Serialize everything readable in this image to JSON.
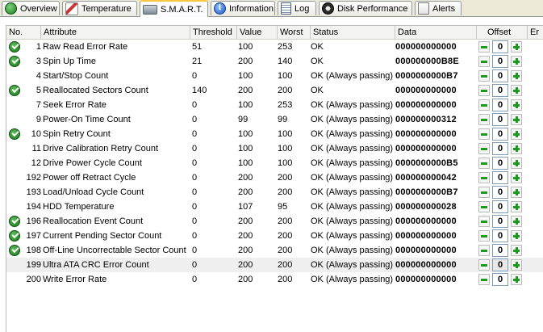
{
  "tabs": [
    {
      "label": "Overview",
      "icon": "overview-icon",
      "active": false
    },
    {
      "label": "Temperature",
      "icon": "temperature-icon",
      "active": false
    },
    {
      "label": "S.M.A.R.T.",
      "icon": "smart-icon",
      "active": true
    },
    {
      "label": "Information",
      "icon": "information-icon",
      "active": false
    },
    {
      "label": "Log",
      "icon": "log-icon",
      "active": false
    },
    {
      "label": "Disk Performance",
      "icon": "disk-performance-icon",
      "active": false
    },
    {
      "label": "Alerts",
      "icon": "alerts-icon",
      "active": false
    }
  ],
  "columns": {
    "no": "No.",
    "attribute": "Attribute",
    "threshold": "Threshold",
    "value": "Value",
    "worst": "Worst",
    "status": "Status",
    "data": "Data",
    "offset": "Offset",
    "extra": "Er"
  },
  "rows": [
    {
      "check": true,
      "no": "1",
      "attribute": "Raw Read Error Rate",
      "threshold": "51",
      "value": "100",
      "worst": "253",
      "status": "OK",
      "data": "000000000000",
      "offset": "0"
    },
    {
      "check": true,
      "no": "3",
      "attribute": "Spin Up Time",
      "threshold": "21",
      "value": "200",
      "worst": "140",
      "status": "OK",
      "data": "000000000B8E",
      "offset": "0"
    },
    {
      "check": false,
      "no": "4",
      "attribute": "Start/Stop Count",
      "threshold": "0",
      "value": "100",
      "worst": "100",
      "status": "OK (Always passing)",
      "data": "0000000000B7",
      "offset": "0"
    },
    {
      "check": true,
      "no": "5",
      "attribute": "Reallocated Sectors Count",
      "threshold": "140",
      "value": "200",
      "worst": "200",
      "status": "OK",
      "data": "000000000000",
      "offset": "0"
    },
    {
      "check": false,
      "no": "7",
      "attribute": "Seek Error Rate",
      "threshold": "0",
      "value": "100",
      "worst": "253",
      "status": "OK (Always passing)",
      "data": "000000000000",
      "offset": "0"
    },
    {
      "check": false,
      "no": "9",
      "attribute": "Power-On Time Count",
      "threshold": "0",
      "value": "99",
      "worst": "99",
      "status": "OK (Always passing)",
      "data": "000000000312",
      "offset": "0"
    },
    {
      "check": true,
      "no": "10",
      "attribute": "Spin Retry Count",
      "threshold": "0",
      "value": "100",
      "worst": "100",
      "status": "OK (Always passing)",
      "data": "000000000000",
      "offset": "0"
    },
    {
      "check": false,
      "no": "11",
      "attribute": "Drive Calibration Retry Count",
      "threshold": "0",
      "value": "100",
      "worst": "100",
      "status": "OK (Always passing)",
      "data": "000000000000",
      "offset": "0"
    },
    {
      "check": false,
      "no": "12",
      "attribute": "Drive Power Cycle Count",
      "threshold": "0",
      "value": "100",
      "worst": "100",
      "status": "OK (Always passing)",
      "data": "0000000000B5",
      "offset": "0"
    },
    {
      "check": false,
      "no": "192",
      "attribute": "Power off Retract Cycle",
      "threshold": "0",
      "value": "200",
      "worst": "200",
      "status": "OK (Always passing)",
      "data": "000000000042",
      "offset": "0"
    },
    {
      "check": false,
      "no": "193",
      "attribute": "Load/Unload Cycle Count",
      "threshold": "0",
      "value": "200",
      "worst": "200",
      "status": "OK (Always passing)",
      "data": "0000000000B7",
      "offset": "0"
    },
    {
      "check": false,
      "no": "194",
      "attribute": "HDD Temperature",
      "threshold": "0",
      "value": "107",
      "worst": "95",
      "status": "OK (Always passing)",
      "data": "000000000028",
      "offset": "0"
    },
    {
      "check": true,
      "no": "196",
      "attribute": "Reallocation Event Count",
      "threshold": "0",
      "value": "200",
      "worst": "200",
      "status": "OK (Always passing)",
      "data": "000000000000",
      "offset": "0"
    },
    {
      "check": true,
      "no": "197",
      "attribute": "Current Pending Sector Count",
      "threshold": "0",
      "value": "200",
      "worst": "200",
      "status": "OK (Always passing)",
      "data": "000000000000",
      "offset": "0"
    },
    {
      "check": true,
      "no": "198",
      "attribute": "Off-Line Uncorrectable Sector Count",
      "threshold": "0",
      "value": "200",
      "worst": "200",
      "status": "OK (Always passing)",
      "data": "000000000000",
      "offset": "0"
    },
    {
      "check": false,
      "no": "199",
      "attribute": "Ultra ATA CRC Error Count",
      "threshold": "0",
      "value": "200",
      "worst": "200",
      "status": "OK (Always passing)",
      "data": "000000000000",
      "offset": "0",
      "highlight": true
    },
    {
      "check": false,
      "no": "200",
      "attribute": "Write Error Rate",
      "threshold": "0",
      "value": "200",
      "worst": "200",
      "status": "OK (Always passing)",
      "data": "000000000000",
      "offset": "0"
    }
  ]
}
